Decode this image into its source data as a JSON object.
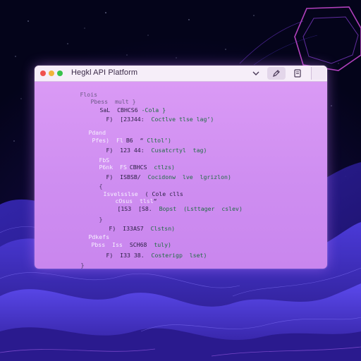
{
  "window": {
    "title": "Hegkl API Platform",
    "toolbar": {
      "chevron_icon": "chevron-down-icon",
      "edit_icon": "pencil-icon",
      "doc_icon": "document-icon"
    }
  },
  "colors": {
    "window_bg": "#d795f5",
    "titlebar_bg": "#f6eef9",
    "accent_green": "#1f6d43",
    "scene_bg": "#05051a"
  },
  "code_lines": [
    {
      "gutter": "Flois",
      "code": ""
    },
    {
      "gutter": "",
      "code": "Pbess  mult }"
    },
    {
      "gutter": "",
      "code": "SaL  CBHCS6 ",
      "tail": "-Cola }"
    },
    {
      "gutter": "",
      "code": "F)  [23J44:  ",
      "tail": "Coctlve tlse lag’)"
    },
    {
      "gutter": "Pdand",
      "code": ""
    },
    {
      "gutter": "Pfes)  Fl",
      "code": "B6  “ ",
      "tail": "Cltol’)"
    },
    {
      "gutter": "",
      "code": "F)  123 44:  ",
      "tail": "Cusatcrtyl  tag)"
    },
    {
      "gutter": "FbS",
      "code": ""
    },
    {
      "gutter": "P6nk  FS",
      "code": "CBHCS  ",
      "tail": "ctlzs)"
    },
    {
      "gutter": "",
      "code": "F)  ISBSB/  ",
      "tail": "Cocidonw  lve  lgrizlon)"
    },
    {
      "gutter": "{",
      "code": ""
    },
    {
      "gutter": "",
      "code": "Isvelsslse  ",
      "tail": "( Cole clls"
    },
    {
      "gutter": "",
      "code": "cOsus  tlsl",
      "tail": "“"
    },
    {
      "gutter": "",
      "code": "[1S3  [S8.  ",
      "tail": "Bopst  (Lsttager  cslev)"
    },
    {
      "gutter": "}",
      "code": ""
    },
    {
      "gutter": "",
      "code": "F)  I33AS7  ",
      "tail": "Clstsn)"
    },
    {
      "gutter": "Pdkefs",
      "code": ""
    },
    {
      "gutter": "Pbss  Iss",
      "code": "SCH68  ",
      "tail": "tuly)"
    },
    {
      "gutter": "",
      "code": "F)  I33 38.  ",
      "tail": "Costerigp  lset)"
    },
    {
      "gutter": "}",
      "code": ""
    }
  ]
}
